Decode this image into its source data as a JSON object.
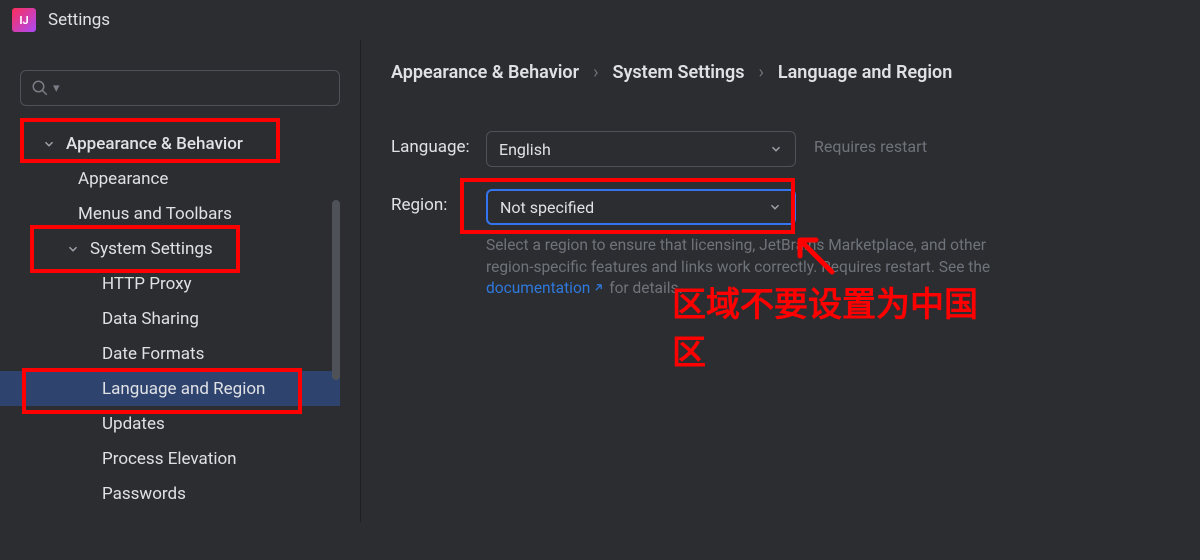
{
  "title": "Settings",
  "breadcrumb": {
    "a": "Appearance & Behavior",
    "b": "System Settings",
    "c": "Language and Region"
  },
  "sidebar": {
    "items": [
      {
        "label": "Appearance & Behavior",
        "level": 0,
        "expanded": true
      },
      {
        "label": "Appearance",
        "level": 1
      },
      {
        "label": "Menus and Toolbars",
        "level": 1
      },
      {
        "label": "System Settings",
        "level": 1,
        "expanded": true
      },
      {
        "label": "HTTP Proxy",
        "level": 2
      },
      {
        "label": "Data Sharing",
        "level": 2
      },
      {
        "label": "Date Formats",
        "level": 2
      },
      {
        "label": "Language and Region",
        "level": 2,
        "selected": true
      },
      {
        "label": "Updates",
        "level": 2
      },
      {
        "label": "Process Elevation",
        "level": 2
      },
      {
        "label": "Passwords",
        "level": 2
      }
    ]
  },
  "form": {
    "language_label": "Language:",
    "language_value": "English",
    "language_hint": "Requires restart",
    "region_label": "Region:",
    "region_value": "Not specified",
    "region_help_a": "Select a region to ensure that licensing, JetBrains Marketplace, and other region-specific features and links work correctly. Requires restart. See the ",
    "region_help_link": "documentation",
    "region_help_b": " for details."
  },
  "annotation": {
    "line1": "区域不要设置为中国",
    "line2": "区"
  }
}
